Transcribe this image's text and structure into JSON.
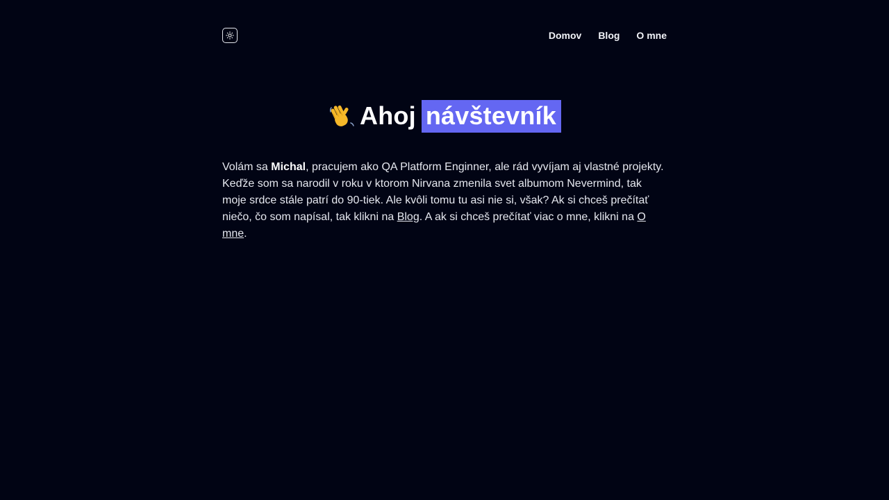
{
  "header": {
    "theme_toggle_icon": "sun-icon",
    "nav": {
      "home": "Domov",
      "blog": "Blog",
      "about": "O mne"
    }
  },
  "hero": {
    "emoji_icon": "waving-hand-icon",
    "greeting": "Ahoj",
    "highlight": "návštevník",
    "highlight_color": "#6467f2"
  },
  "intro": {
    "part1": "Volám sa ",
    "name": "Michal",
    "part2": ", pracujem ako QA Platform Enginner, ale rád vyvíjam aj vlastné projekty. Keďže som sa narodil v roku v ktorom Nirvana zmenila svet albumom Nevermind, tak moje srdce stále patrí do 90-tiek. Ale kvôli tomu tu asi nie si, však? Ak si chceš prečítať niečo, čo som napísal, tak klikni na ",
    "blog_link": "Blog",
    "part3": ". A ak si chceš prečítať viac o mne, klikni na ",
    "about_link": "O mne",
    "part4": "."
  },
  "colors": {
    "background": "#010414",
    "text": "#e6e8ef",
    "accent": "#6467f2"
  }
}
